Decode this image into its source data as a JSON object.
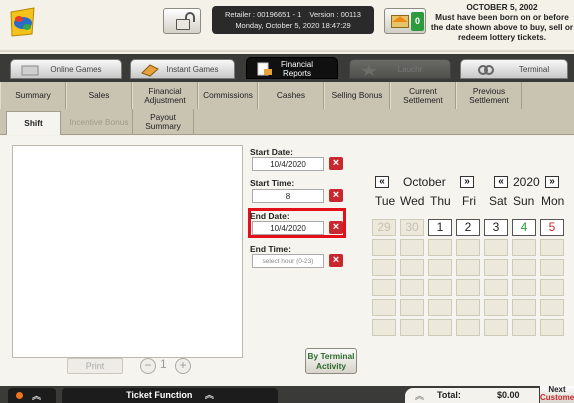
{
  "header": {
    "retailer_text": "Retailer : 00196651 - 1",
    "version_text": "Version : 00113",
    "datetime": "Monday, October 5, 2020 18:47:29",
    "message_count": "0",
    "age_date": "OCTOBER 5, 2002",
    "age_text": "Must have been born on or before the date shown above to buy, sell or redeem lottery tickets."
  },
  "main_tabs": [
    {
      "label": "Online Games",
      "state": "normal"
    },
    {
      "label": "Instant Games",
      "state": "normal"
    },
    {
      "label": "Financial Reports",
      "state": "active"
    },
    {
      "label": "Lauchr",
      "state": "disabled"
    },
    {
      "label": "Terminal",
      "state": "normal"
    }
  ],
  "sub_tabs": [
    "Summary",
    "Sales",
    "Financial Adjustment",
    "Commissions",
    "Cashes",
    "Selling Bonus",
    "Current Settlement",
    "Previous Settlement"
  ],
  "sub_tabs2": [
    "Shift",
    "Incentive Bonus",
    "Payout Summary"
  ],
  "controls": {
    "print_label": "Print",
    "page_number": "1",
    "start_date_label": "Start Date:",
    "start_date_value": "10/4/2020",
    "start_time_label": "Start Time:",
    "start_time_value": "8",
    "end_date_label": "End Date:",
    "end_date_value": "10/4/2020",
    "end_time_label": "End Time:",
    "end_time_placeholder": "select hour (0-23)",
    "by_terminal_label": "By Terminal Activity",
    "clear_label": "×"
  },
  "calendar": {
    "prev_month": "«",
    "next_month": "»",
    "month": "October",
    "year": "2020",
    "weekdays": [
      "Tue",
      "Wed",
      "Thu",
      "Fri",
      "Sat",
      "Sun",
      "Mon"
    ],
    "first_row": [
      {
        "day": "29",
        "kind": "prev"
      },
      {
        "day": "30",
        "kind": "prev"
      },
      {
        "day": "1",
        "kind": "cur"
      },
      {
        "day": "2",
        "kind": "cur"
      },
      {
        "day": "3",
        "kind": "cur"
      },
      {
        "day": "4",
        "kind": "green"
      },
      {
        "day": "5",
        "kind": "red"
      }
    ]
  },
  "bottom": {
    "ticket_function_label": "Ticket Function",
    "total_label": "Total:",
    "total_value": "$0.00",
    "next_line1": "Next",
    "next_line2": "Customer"
  },
  "colors": {
    "accent_red": "#c8282d",
    "highlight_red": "#e3101a",
    "today_green": "#2a9a3a",
    "dark_bar": "#3a3a38"
  }
}
